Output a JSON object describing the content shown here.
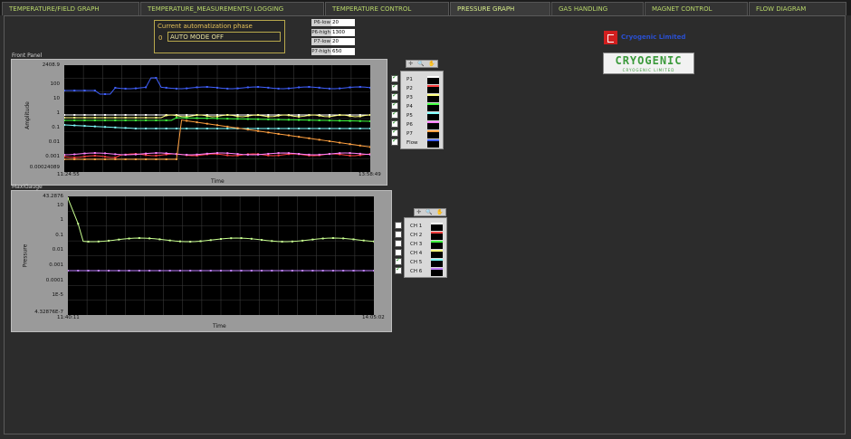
{
  "tabs": [
    {
      "label": "TEMPERATURE/FIELD GRAPH",
      "active": false
    },
    {
      "label": "TEMPERATURE_MEASUREMENTS/ LOGGING",
      "active": false
    },
    {
      "label": "TEMPERATURE CONTROL",
      "active": false
    },
    {
      "label": "PRESSURE GRAPH",
      "active": true
    },
    {
      "label": "GAS HANDLING",
      "active": false
    },
    {
      "label": "MAGNET CONTROL",
      "active": false
    },
    {
      "label": "FLOW DIAGRAM",
      "active": false
    }
  ],
  "phase": {
    "title": "Current automatization phase",
    "number": "0",
    "value": "AUTO MODE OFF"
  },
  "params": [
    {
      "label": "P6-low",
      "value": "20"
    },
    {
      "label": "P6-high",
      "value": "1300"
    },
    {
      "label": "P7-low",
      "value": "20"
    },
    {
      "label": "P7-high",
      "value": "650"
    }
  ],
  "logos": {
    "brand_a_text": "Cryogenic Limited",
    "brand_b_main": "CRYOGENIC",
    "brand_b_sub": "CRYOGENIC LIMITED",
    "brand_a_color": "#d11f1f",
    "brand_b_color": "#3b9a3b"
  },
  "front_panel": {
    "title": "Front Panel",
    "ylabel": "Amplitude",
    "xlabel": "Time",
    "x_start": "11:24:55",
    "x_end": "13:58:49",
    "y_ticks": [
      "2408.9",
      "100",
      "10",
      "1",
      "0.1",
      "0.01",
      "0.001",
      "0.00024089"
    ],
    "legend": [
      {
        "name": "P1",
        "color": "#ffffff",
        "checked": true
      },
      {
        "name": "P2",
        "color": "#ff4040",
        "checked": true
      },
      {
        "name": "P3",
        "color": "#ffff80",
        "checked": true
      },
      {
        "name": "P4",
        "color": "#40ff40",
        "checked": true
      },
      {
        "name": "P5",
        "color": "#80ffff",
        "checked": true
      },
      {
        "name": "P6",
        "color": "#ff80ff",
        "checked": true
      },
      {
        "name": "P7",
        "color": "#ffa040",
        "checked": true
      },
      {
        "name": "Flow",
        "color": "#4060ff",
        "checked": true
      }
    ]
  },
  "maxi_gauge": {
    "title": "MaxiGauge",
    "ylabel": "Pressure",
    "xlabel": "Time",
    "x_start": "11:40:11",
    "x_end": "14:05:02",
    "y_ticks": [
      "43.2876",
      "10",
      "1",
      "0.1",
      "0.01",
      "0.001",
      "0.0001",
      "1E-5",
      "4.32876E-7"
    ],
    "legend": [
      {
        "name": "CH 1",
        "color": "#ffffff",
        "checked": false
      },
      {
        "name": "CH 2",
        "color": "#ff4040",
        "checked": false
      },
      {
        "name": "CH 3",
        "color": "#40ff40",
        "checked": false
      },
      {
        "name": "CH 4",
        "color": "#ffff80",
        "checked": false
      },
      {
        "name": "CH 5",
        "color": "#80ffff",
        "checked": true
      },
      {
        "name": "CH 6",
        "color": "#c080ff",
        "checked": true
      }
    ]
  }
}
